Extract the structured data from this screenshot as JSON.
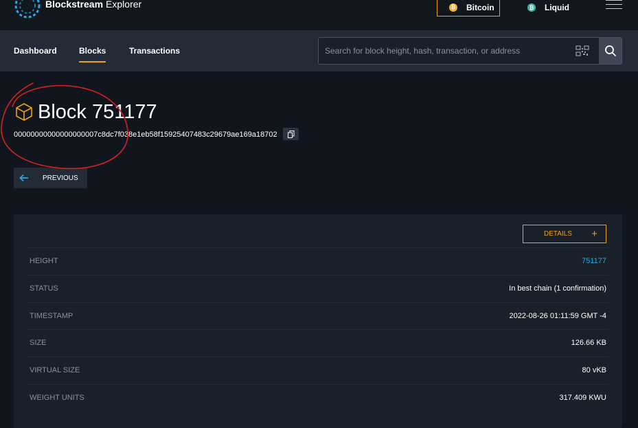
{
  "header": {
    "brand_bold": "Blockstream",
    "brand_light": "Explorer",
    "networks": [
      {
        "label": "Bitcoin",
        "icon": "bitcoin-coin-icon",
        "active": true
      },
      {
        "label": "Liquid",
        "icon": "liquid-coin-icon",
        "active": false
      }
    ]
  },
  "nav": {
    "items": [
      "Dashboard",
      "Blocks",
      "Transactions"
    ],
    "active": "Blocks"
  },
  "search": {
    "placeholder": "Search for block height, hash, transaction, or address"
  },
  "block": {
    "title": "Block 751177",
    "hash": "00000000000000000007c8dc7f038e1eb58f15925407483c29679ae169a18702",
    "previous_label": "PREVIOUS"
  },
  "details": {
    "button_label": "DETAILS",
    "rows": [
      {
        "label": "HEIGHT",
        "value": "751177",
        "link": true
      },
      {
        "label": "STATUS",
        "value": "In best chain (1 confirmation)",
        "link": false
      },
      {
        "label": "TIMESTAMP",
        "value": "2022-08-26 01:11:59 GMT -4",
        "link": false
      },
      {
        "label": "SIZE",
        "value": "126.66 KB",
        "link": false
      },
      {
        "label": "VIRTUAL SIZE",
        "value": "80 vKB",
        "link": false
      },
      {
        "label": "WEIGHT UNITS",
        "value": "317.409 KWU",
        "link": false
      }
    ]
  },
  "colors": {
    "accent": "#f0a30a",
    "link": "#2aa8e0",
    "annotation": "#d92020"
  }
}
